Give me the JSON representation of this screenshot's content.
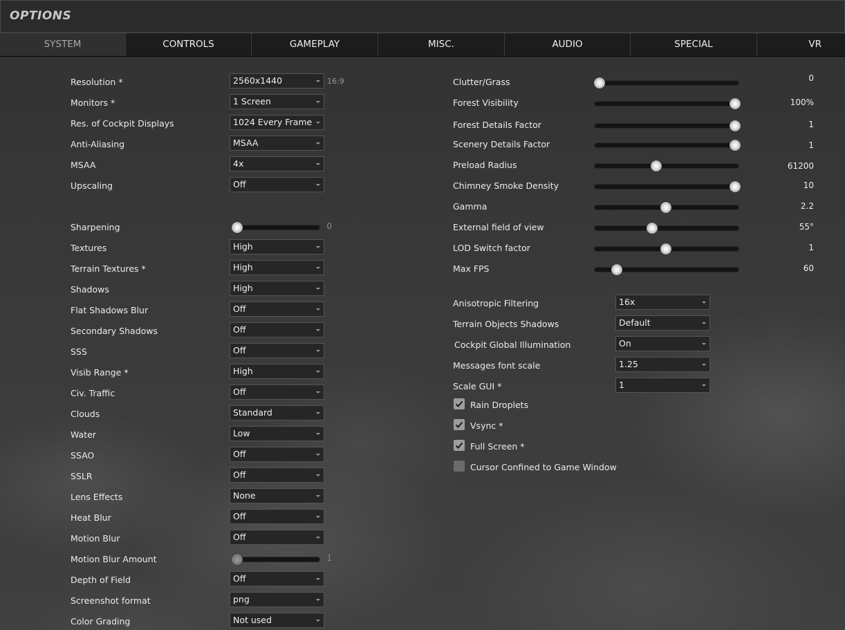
{
  "window": {
    "title": "OPTIONS"
  },
  "tabs": [
    "SYSTEM",
    "CONTROLS",
    "GAMEPLAY",
    "MISC.",
    "AUDIO",
    "SPECIAL",
    "VR"
  ],
  "active_tab": "SYSTEM",
  "left_dropdowns_top": [
    {
      "label": "Resolution *",
      "value": "2560x1440"
    },
    {
      "label": "Monitors *",
      "value": "1 Screen"
    },
    {
      "label": "Res. of Cockpit Displays",
      "value": "1024 Every Frame"
    },
    {
      "label": "Anti-Aliasing",
      "value": "MSAA"
    },
    {
      "label": "MSAA",
      "value": "4x"
    },
    {
      "label": "Upscaling",
      "value": "Off"
    }
  ],
  "resolution_aspect": "16:9",
  "sharpening": {
    "label": "Sharpening",
    "value": "0",
    "level": 0
  },
  "left_dropdowns_bottom": [
    {
      "label": "Textures",
      "value": "High"
    },
    {
      "label": "Terrain Textures *",
      "value": "High"
    },
    {
      "label": "Shadows",
      "value": "High"
    },
    {
      "label": "Flat Shadows Blur",
      "value": "Off"
    },
    {
      "label": "Secondary Shadows",
      "value": "Off"
    },
    {
      "label": "SSS",
      "value": "Off"
    },
    {
      "label": "Visib Range *",
      "value": "High"
    },
    {
      "label": "Civ. Traffic",
      "value": "Off"
    },
    {
      "label": "Clouds",
      "value": "Standard"
    },
    {
      "label": "Water",
      "value": "Low"
    },
    {
      "label": "SSAO",
      "value": "Off"
    },
    {
      "label": "SSLR",
      "value": "Off"
    },
    {
      "label": "Lens Effects",
      "value": "None"
    },
    {
      "label": "Heat Blur",
      "value": "Off"
    },
    {
      "label": "Motion Blur",
      "value": "Off"
    }
  ],
  "motion_blur_amount": {
    "label": "Motion Blur Amount",
    "value": "1",
    "level": 0
  },
  "left_dropdowns_end": [
    {
      "label": "Depth of Field",
      "value": "Off"
    },
    {
      "label": "Screenshot format",
      "value": "png"
    },
    {
      "label": "Color Grading",
      "value": "Not used"
    }
  ],
  "right_sliders": [
    {
      "label": "Clutter/Grass",
      "value": "0",
      "level": 0.0
    },
    {
      "label": "Forest Visibility",
      "value": "100%",
      "level": 1.0
    },
    {
      "label": "Forest Details Factor",
      "value": "1",
      "level": 1.0
    },
    {
      "label": "Scenery Details Factor",
      "value": "1",
      "level": 1.0
    },
    {
      "label": "Preload Radius",
      "value": "61200",
      "level": 0.42
    },
    {
      "label": "Chimney Smoke Density",
      "value": "10",
      "level": 1.0
    },
    {
      "label": "Gamma",
      "value": "2.2",
      "level": 0.49
    },
    {
      "label": "External field of view",
      "value": "55°",
      "level": 0.39
    },
    {
      "label": "LOD Switch factor",
      "value": "1",
      "level": 0.49
    },
    {
      "label": "Max FPS",
      "value": "60",
      "level": 0.13
    }
  ],
  "right_dropdowns": [
    {
      "label": "Anisotropic Filtering",
      "value": "16x"
    },
    {
      "label": "Terrain Objects Shadows",
      "value": "Default"
    },
    {
      "label": "Cockpit Global Illumination",
      "value": "On"
    },
    {
      "label": "Messages font scale",
      "value": "1.25"
    },
    {
      "label": "Scale GUI *",
      "value": "1"
    }
  ],
  "checkboxes": [
    {
      "label": "Rain Droplets",
      "checked": true
    },
    {
      "label": "Vsync *",
      "checked": true
    },
    {
      "label": "Full Screen *",
      "checked": true
    },
    {
      "label": "Cursor Confined to Game Window",
      "checked": false
    }
  ]
}
